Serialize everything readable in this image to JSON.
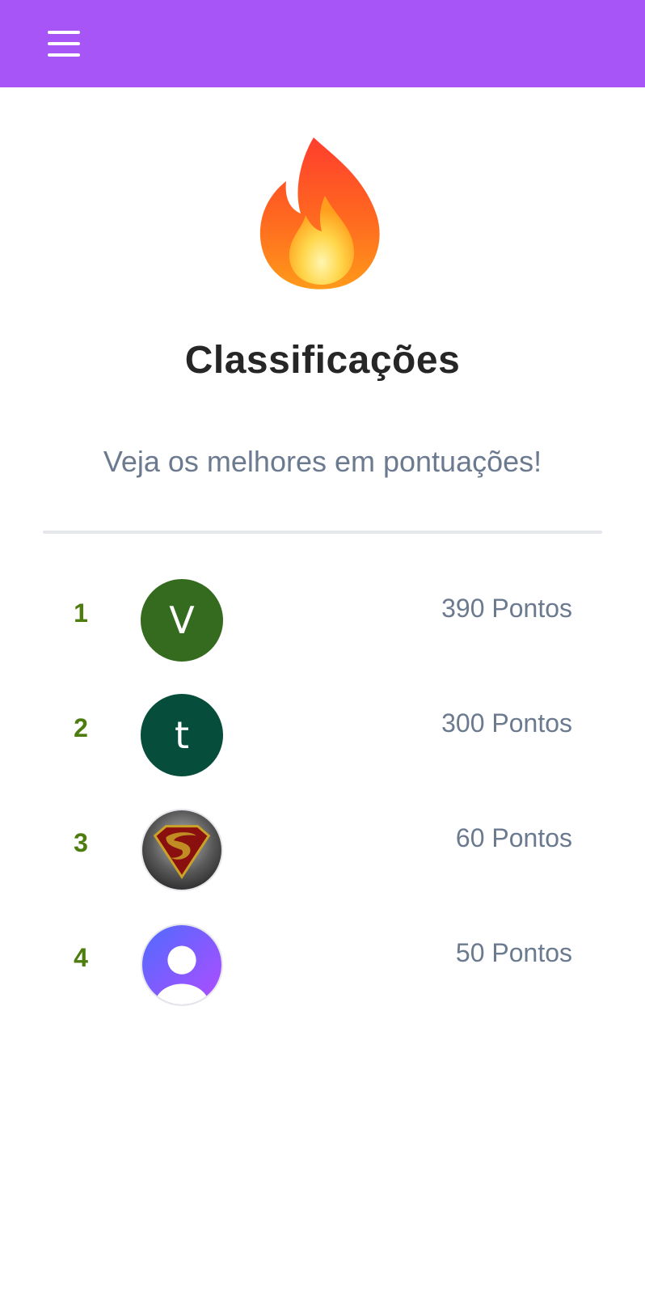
{
  "header": {
    "menu_icon": "hamburger-menu-icon",
    "background_color": "#a855f7"
  },
  "hero": {
    "icon": "fire-icon",
    "title": "Classificações",
    "subtitle": "Veja os melhores em pontuações!"
  },
  "ranking": [
    {
      "position": "1",
      "avatar_type": "letter",
      "avatar_text": "V",
      "avatar_color": "#356b1e",
      "points": "390 Pontos"
    },
    {
      "position": "2",
      "avatar_type": "letter",
      "avatar_text": "t",
      "avatar_color": "#064e3b",
      "points": "300 Pontos"
    },
    {
      "position": "3",
      "avatar_type": "image",
      "avatar_icon": "superman-emblem-icon",
      "points": "60 Pontos"
    },
    {
      "position": "4",
      "avatar_type": "image",
      "avatar_icon": "default-user-icon",
      "points": "50 Pontos"
    }
  ],
  "colors": {
    "rank_number": "#4d7c0f",
    "points_text": "#6b7a8f",
    "title_text": "#262626"
  }
}
